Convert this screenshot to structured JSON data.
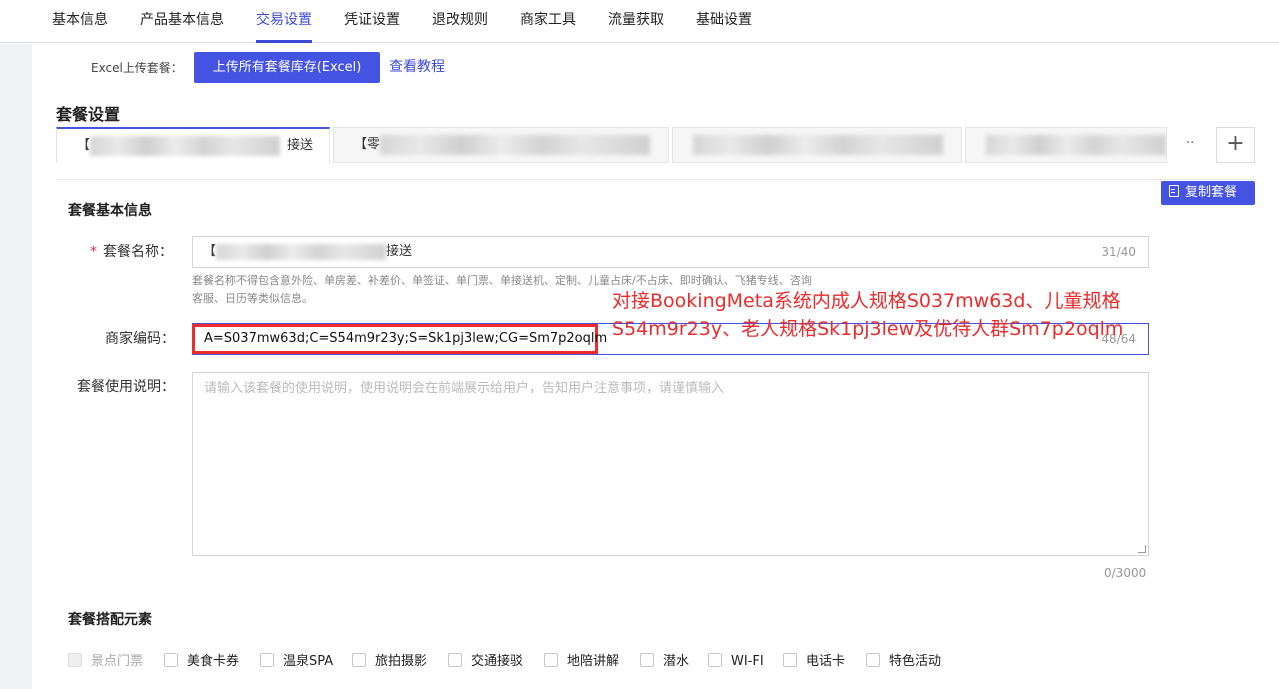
{
  "top_nav": {
    "tabs": [
      "基本信息",
      "产品基本信息",
      "交易设置",
      "凭证设置",
      "退改规则",
      "商家工具",
      "流量获取",
      "基础设置"
    ],
    "active": "交易设置"
  },
  "excel": {
    "label": "Excel上传套餐：",
    "upload_button": "上传所有套餐库存(Excel)",
    "tutorial_link": "查看教程"
  },
  "package_settings": {
    "title": "套餐设置",
    "tabs": [
      {
        "prefix": "【",
        "suffix": "接送"
      },
      {
        "prefix": "【零",
        "suffix": ""
      },
      {
        "prefix": "",
        "suffix": ""
      },
      {
        "prefix": "",
        "suffix": ""
      }
    ],
    "more": "··",
    "add": "+",
    "copy_button": "复制套餐"
  },
  "basic_info": {
    "title": "套餐基本信息",
    "name_label": "套餐名称：",
    "name_prefix": "【",
    "name_suffix": "接送",
    "name_counter": "31/40",
    "name_hint": "套餐名称不得包含意外险、单房差、补差价、单签证、单门票、单接送机、定制、儿童占床/不占床、即时确认、飞猪专线、咨询客服、日历等类似信息。",
    "code_label": "商家编码：",
    "code_value": "A=S037mw63d;C=S54m9r23y;S=Sk1pj3lew;CG=Sm7p2oqlm",
    "code_counter": "48/64",
    "desc_label": "套餐使用说明：",
    "desc_placeholder": "请输入该套餐的使用说明，使用说明会在前端展示给用户，告知用户注意事项，请谨慎输入",
    "desc_counter": "0/3000"
  },
  "annotation": "对接BookingMeta系统内成人规格S037mw63d、儿童规格S54m9r23y、老人规格Sk1pj3lew及优待人群Sm7p2oqlm",
  "elements": {
    "title": "套餐搭配元素",
    "options": [
      "景点门票",
      "美食卡券",
      "温泉SPA",
      "旅拍摄影",
      "交通接驳",
      "地陪讲解",
      "潜水",
      "WI-FI",
      "电话卡",
      "特色活动"
    ]
  }
}
